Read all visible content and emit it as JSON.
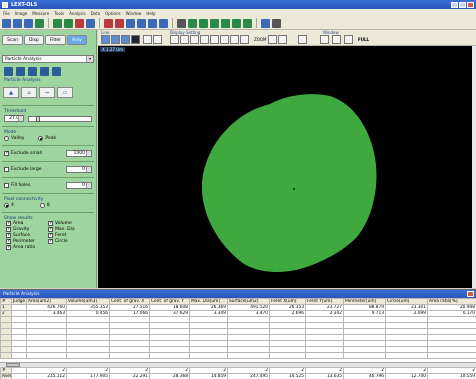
{
  "window": {
    "title": "LEXT-OLS"
  },
  "menu": [
    "File",
    "Image",
    "Measure",
    "Tools",
    "Analysis",
    "Data",
    "Options",
    "Window",
    "Help"
  ],
  "toolbar": {
    "icons": [
      "new-icon",
      "open-icon",
      "save-icon",
      "print-icon",
      "copy-icon",
      "paste-icon",
      "undo-icon",
      "zoom-icon",
      "ruler-icon",
      "profile-icon",
      "area-icon",
      "step-icon",
      "rough-icon",
      "particle-icon",
      "search-icon",
      "measure-icon",
      "line-icon",
      "angle-icon",
      "circle-icon",
      "grid-icon",
      "arrow-icon",
      "help-icon",
      "report-icon"
    ],
    "colors": [
      "#3a6ab8",
      "#3a6ab8",
      "#3a6ab8",
      "#2a8a4a",
      "#2a8a4a",
      "#2a8a4a",
      "#b83a3a",
      "#3a6ab8",
      "#b83a3a",
      "#b83a3a",
      "#3a6ab8",
      "#3a6ab8",
      "#3a6ab8",
      "#3a6ab8",
      "#555555",
      "#2a8a4a",
      "#2a8a4a",
      "#2a8a4a",
      "#2a8a4a",
      "#2a8a4a",
      "#2a8a4a",
      "#3a6ab8",
      "#555555"
    ]
  },
  "left": {
    "tabs": [
      "Scan",
      "Disp",
      "Filter",
      "Anly"
    ],
    "analysis_select": "Particle Analysis",
    "analysis_label": "Particle Analysis",
    "threshold_label": "Threshold",
    "threshold_value": "27.06",
    "threshold_fraction": 0.12,
    "mode_label": "Mode",
    "mode_valley": "Valley",
    "mode_peak": "Peak",
    "exclude_small_label": "Exclude small",
    "exclude_small_value": "1000",
    "exclude_large_label": "Exclude large",
    "exclude_large_value": "0",
    "fill_holes_label": "Fill holes",
    "fill_holes_value": "0",
    "pixel_conn_label": "Pixel connectivity",
    "conn_4": "4",
    "conn_8": "8",
    "show_results_label": "Show results",
    "results": [
      {
        "label": "Area",
        "checked": true
      },
      {
        "label": "Volume",
        "checked": true
      },
      {
        "label": "Gravity",
        "checked": true
      },
      {
        "label": "Max. Dia",
        "checked": true
      },
      {
        "label": "Surface",
        "checked": true
      },
      {
        "label": "Feret",
        "checked": true
      },
      {
        "label": "Perimeter",
        "checked": true
      },
      {
        "label": "Circle",
        "checked": true
      },
      {
        "label": "Area ratio",
        "checked": true
      }
    ]
  },
  "image_header": {
    "line_group": "Line",
    "display_group": "Display Setting",
    "window_group": "Window",
    "full_label": "FULL",
    "zoom_label": "ZOOM"
  },
  "image": {
    "tag": "X 1.27 Um",
    "blob_color": "#3fa83f",
    "background": "#000000"
  },
  "results_table": {
    "title": "Particle Analysis",
    "headers": [
      "#",
      "Judge",
      "Area[um2]",
      "Volume[um3]",
      "Cent. of grav. X",
      "Cent. of grav. Y",
      "Max. Dia[um]",
      "Surface[um2]",
      "Feret X[um]",
      "Feret Y[um]",
      "Perimeter[um]",
      "Circle[um]",
      "Area ratio[%]"
    ],
    "rows": [
      [
        "1",
        "",
        "426.760",
        "355.353",
        "27.516",
        "18.608",
        "26.369",
        "491.520",
        "26.353",
        "23.727",
        "88.879",
        "23.301",
        "20.948"
      ],
      [
        "2",
        "",
        "3.463",
        "0.456",
        "17.066",
        "37.629",
        "3.349",
        "3.470",
        "2.696",
        "2.342",
        "9.713",
        "2.099",
        "0.170"
      ],
      [
        "",
        "",
        "",
        "",
        "",
        "",
        "",
        "",
        "",
        "",
        "",
        "",
        ""
      ],
      [
        "",
        "",
        "",
        "",
        "",
        "",
        "",
        "",
        "",
        "",
        "",
        "",
        ""
      ],
      [
        "",
        "",
        "",
        "",
        "",
        "",
        "",
        "",
        "",
        "",
        "",
        "",
        ""
      ],
      [
        "",
        "",
        "",
        "",
        "",
        "",
        "",
        "",
        "",
        "",
        "",
        "",
        ""
      ],
      [
        "",
        "",
        "",
        "",
        "",
        "",
        "",
        "",
        "",
        "",
        "",
        "",
        ""
      ],
      [
        "",
        "",
        "",
        "",
        "",
        "",
        "",
        "",
        "",
        "",
        "",
        "",
        ""
      ],
      [
        "",
        "",
        "",
        "",
        "",
        "",
        "",
        "",
        "",
        "",
        "",
        "",
        ""
      ]
    ],
    "summary": [
      [
        "#",
        "",
        "2",
        "2",
        "2",
        "2",
        "2",
        "2",
        "2",
        "2",
        "2",
        "2",
        "2"
      ],
      [
        "Average",
        "",
        "215.112",
        "177.905",
        "22.291",
        "28.368",
        "14.859",
        "247.495",
        "14.525",
        "13.035",
        "46.796",
        "12.700",
        "10.559"
      ]
    ]
  }
}
